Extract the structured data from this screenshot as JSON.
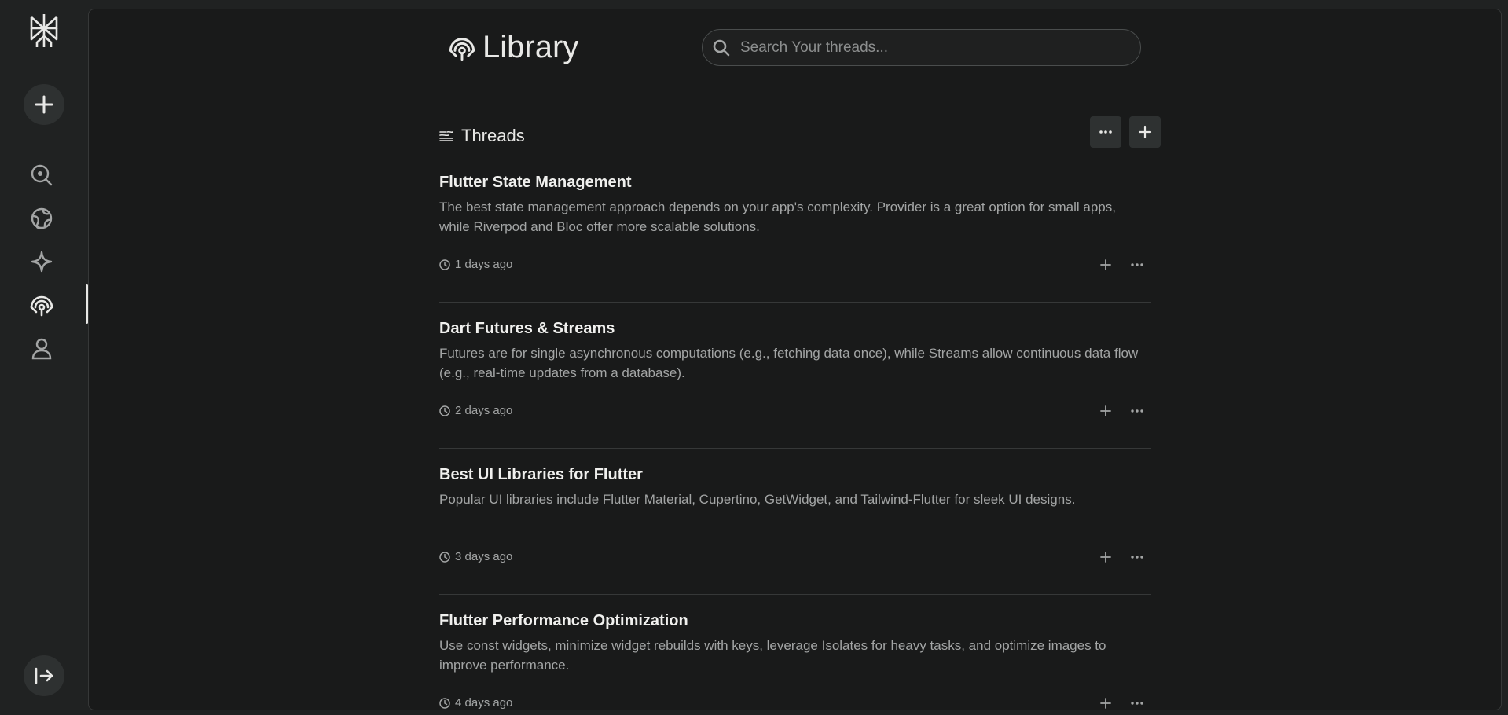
{
  "header": {
    "title": "Library",
    "search_placeholder": "Search Your threads..."
  },
  "threads_section": {
    "title": "Threads"
  },
  "threads": [
    {
      "title": "Flutter State Management",
      "body": "The best state management approach depends on your app's complexity. Provider is a great option for small apps, while Riverpod and Bloc offer more scalable solutions.",
      "time": "1 days ago"
    },
    {
      "title": "Dart Futures & Streams",
      "body": "Futures are for single asynchronous computations (e.g., fetching data once), while Streams allow continuous data flow (e.g., real-time updates from a database).",
      "time": "2 days ago"
    },
    {
      "title": "Best UI Libraries for Flutter",
      "body": "Popular UI libraries include Flutter Material, Cupertino, GetWidget, and Tailwind-Flutter for sleek UI designs.",
      "time": "3 days ago"
    },
    {
      "title": "Flutter Performance Optimization",
      "body": "Use const widgets, minimize widget rebuilds with keys, leverage Isolates for heavy tasks, and optimize images to improve performance.",
      "time": "4 days ago"
    }
  ],
  "sidebar": {
    "icons": [
      "logo-icon",
      "plus-icon",
      "search-icon",
      "globe-icon",
      "sparkle-icon",
      "library-icon",
      "user-icon",
      "collapse-icon"
    ],
    "active": "library"
  },
  "colors": {
    "background": "#202222",
    "panel": "#191a1a",
    "text": "#e8e8e6",
    "muted": "#a3a5a5",
    "border": "#363838"
  }
}
